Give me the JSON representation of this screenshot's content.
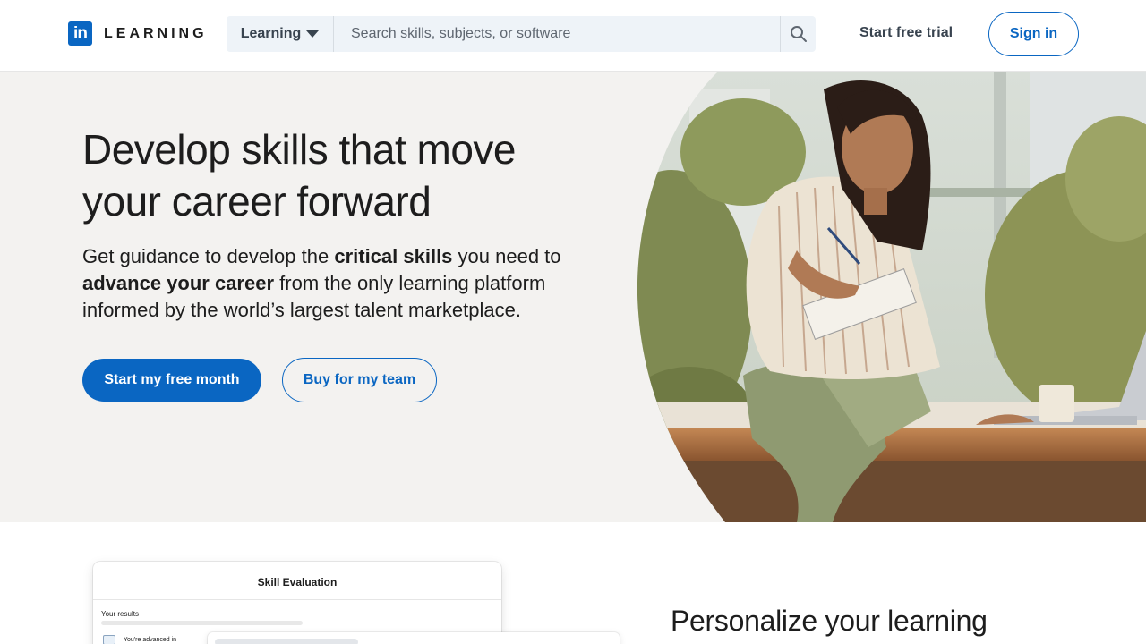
{
  "header": {
    "logo_mark": "in",
    "logo_text": "LEARNING",
    "search_category": "Learning",
    "search_placeholder": "Search skills, subjects, or software",
    "start_trial_label": "Start free trial",
    "sign_in_label": "Sign in"
  },
  "hero": {
    "title": "Develop skills that move your career forward",
    "subtitle_parts": {
      "p1": "Get guidance to develop the ",
      "b1": "critical skills",
      "p2": " you need to ",
      "b2": "advance your career",
      "p3": " from the only learning platform informed by the world’s largest talent marketplace."
    },
    "primary_button": "Start my free month",
    "secondary_button": "Buy for my team"
  },
  "skill_card": {
    "title": "Skill Evaluation",
    "results_label": "Your results",
    "item_text": "You're advanced in"
  },
  "section": {
    "title": "Personalize your learning"
  },
  "colors": {
    "brand": "#0a66c2",
    "hero_bg": "#f3f2f0",
    "search_bg": "#eef3f8"
  },
  "icons": {
    "search": "search-icon",
    "dropdown": "chevron-down-icon"
  }
}
